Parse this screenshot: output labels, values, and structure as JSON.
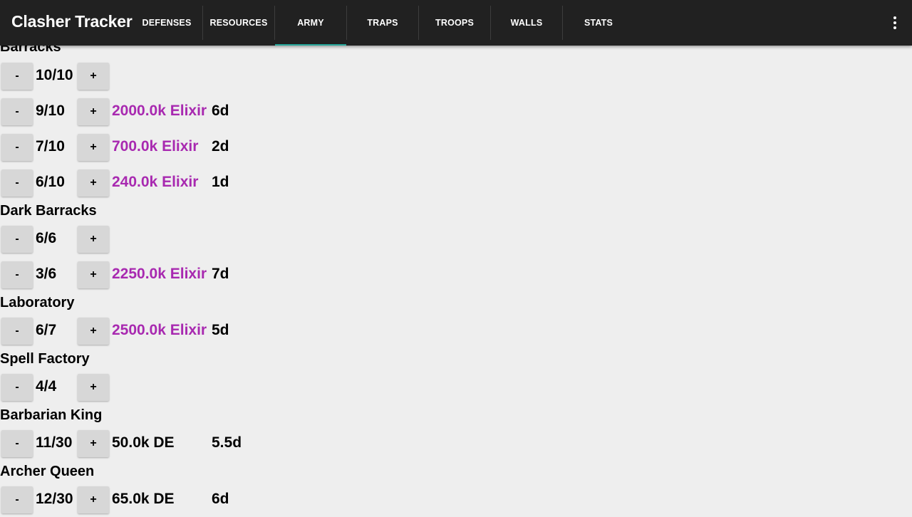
{
  "appbar": {
    "title": "Clasher Tracker",
    "tabs": [
      {
        "label": "DEFENSES"
      },
      {
        "label": "RESOURCES"
      },
      {
        "label": "ARMY",
        "active": true
      },
      {
        "label": "TRAPS"
      },
      {
        "label": "TROOPS"
      },
      {
        "label": "WALLS"
      },
      {
        "label": "STATS"
      }
    ],
    "accent_color": "#26a69a"
  },
  "controls": {
    "minus": "-",
    "plus": "+"
  },
  "colors": {
    "elixir": "#a829b0",
    "dark_elixir": "#000000"
  },
  "sections": [
    {
      "title": "Barracks",
      "rows": [
        {
          "level": "10/10",
          "cost": "",
          "time": ""
        },
        {
          "level": "9/10",
          "cost": "2000.0k Elixir",
          "time": "6d"
        },
        {
          "level": "7/10",
          "cost": "700.0k Elixir",
          "time": "2d"
        },
        {
          "level": "6/10",
          "cost": "240.0k Elixir",
          "time": "1d"
        }
      ]
    },
    {
      "title": "Dark Barracks",
      "rows": [
        {
          "level": "6/6",
          "cost": "",
          "time": ""
        },
        {
          "level": "3/6",
          "cost": "2250.0k Elixir",
          "time": "7d"
        }
      ]
    },
    {
      "title": "Laboratory",
      "rows": [
        {
          "level": "6/7",
          "cost": "2500.0k Elixir",
          "time": "5d"
        }
      ]
    },
    {
      "title": "Spell Factory",
      "rows": [
        {
          "level": "4/4",
          "cost": "",
          "time": ""
        }
      ]
    },
    {
      "title": "Barbarian King",
      "rows": [
        {
          "level": "11/30",
          "cost": "50.0k DE",
          "time": "5.5d"
        }
      ]
    },
    {
      "title": "Archer Queen",
      "rows": [
        {
          "level": "12/30",
          "cost": "65.0k DE",
          "time": "6d"
        }
      ]
    }
  ]
}
